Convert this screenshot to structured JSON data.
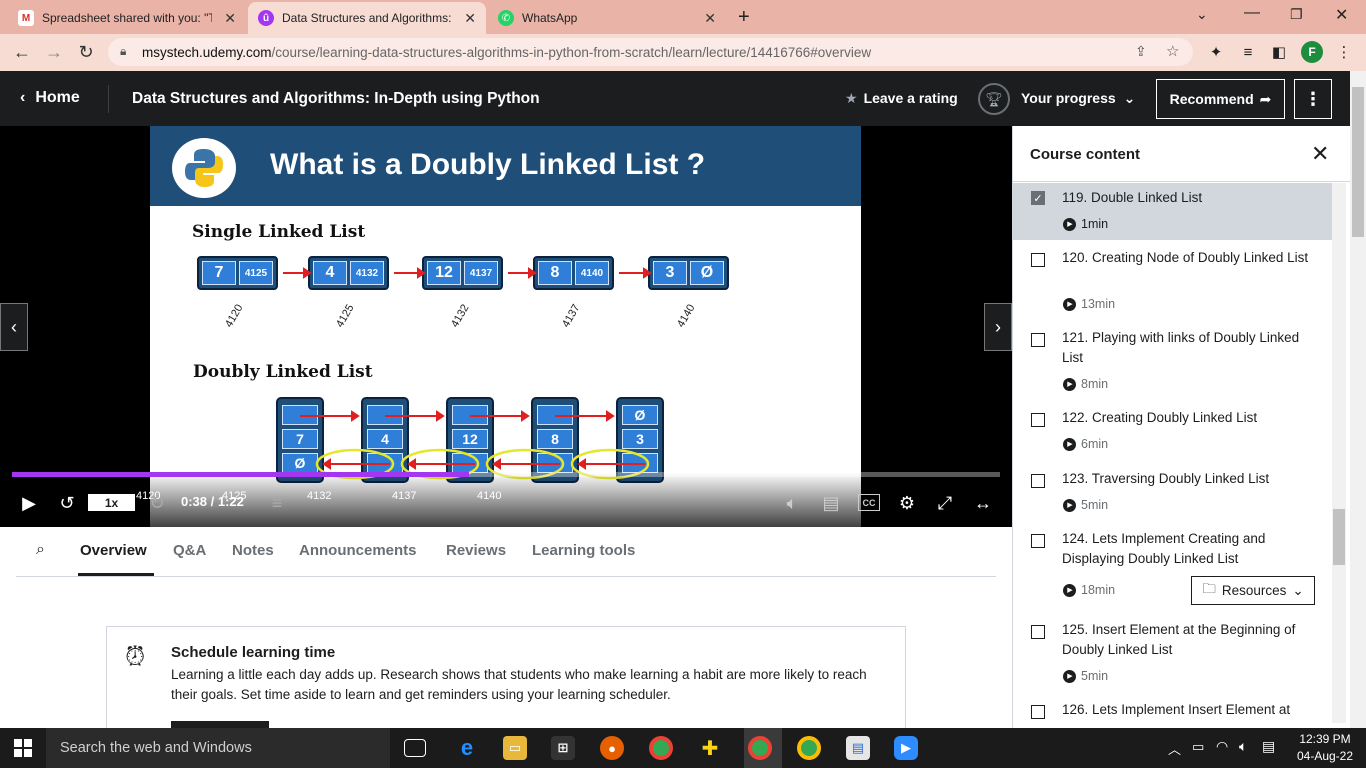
{
  "browser": {
    "tabs": [
      {
        "title": "Spreadsheet shared with you: \"Ti",
        "icon": "gmail-icon"
      },
      {
        "title": "Data Structures and Algorithms: I",
        "icon": "udemy-icon"
      },
      {
        "title": "WhatsApp",
        "icon": "whatsapp-icon"
      }
    ],
    "url_host": "msystech.udemy.com",
    "url_path": "/course/learning-data-structures-algorithms-in-python-from-scratch/learn/lecture/14416766#overview",
    "profile_initial": "F"
  },
  "header": {
    "home": "Home",
    "course_title": "Data Structures and Algorithms: In-Depth using Python",
    "rate": "Leave a rating",
    "progress": "Your progress",
    "recommend": "Recommend"
  },
  "slide": {
    "title": "What is a Doubly Linked List ?",
    "single_label": "Single Linked List",
    "doubly_label": "Doubly Linked List",
    "single_nodes": [
      {
        "value": "7",
        "next": "4125",
        "addr": "4120"
      },
      {
        "value": "4",
        "next": "4132",
        "addr": "4125"
      },
      {
        "value": "12",
        "next": "4137",
        "addr": "4132"
      },
      {
        "value": "8",
        "next": "4140",
        "addr": "4137"
      },
      {
        "value": "3",
        "next": "Ø",
        "addr": "4140"
      }
    ],
    "doubly_nodes": [
      {
        "value": "7",
        "prev": "Ø",
        "addr": "4120"
      },
      {
        "value": "4",
        "addr": "4125"
      },
      {
        "value": "12",
        "addr": "4132"
      },
      {
        "value": "8",
        "addr": "4137"
      },
      {
        "value": "3",
        "next": "Ø",
        "addr": "4140"
      }
    ]
  },
  "player": {
    "speed": "1x",
    "time": "0:38 / 1:22",
    "progress_fraction": 0.463
  },
  "course_tabs": [
    "Overview",
    "Q&A",
    "Notes",
    "Announcements",
    "Reviews",
    "Learning tools"
  ],
  "schedule": {
    "title": "Schedule learning time",
    "desc": "Learning a little each day adds up. Research shows that students who make learning a habit are more likely to reach their goals. Set time aside to learn and get reminders using your learning scheduler."
  },
  "sidebar": {
    "title": "Course content",
    "resources": "Resources",
    "lectures": [
      {
        "title": "119. Double Linked List",
        "duration": "1min",
        "done": true
      },
      {
        "title": "120. Creating Node of Doubly Linked List",
        "duration": "13min",
        "done": false
      },
      {
        "title": "121. Playing with links of Doubly Linked List",
        "duration": "8min",
        "done": false
      },
      {
        "title": "122. Creating Doubly Linked List",
        "duration": "6min",
        "done": false
      },
      {
        "title": "123. Traversing Doubly Linked List",
        "duration": "5min",
        "done": false
      },
      {
        "title": "124. Lets Implement Creating and Displaying Doubly Linked List",
        "duration": "18min",
        "done": false
      },
      {
        "title": "125. Insert Element at the Beginning of Doubly Linked List",
        "duration": "5min",
        "done": false
      },
      {
        "title": "126. Lets Implement Insert Element at",
        "duration": "",
        "done": false
      }
    ]
  },
  "taskbar": {
    "search": "Search the web and Windows",
    "time": "12:39 PM",
    "date": "04-Aug-22"
  },
  "colors": {
    "tabbar": "#e9b3a7",
    "udemy_dark": "#1c1d1f",
    "progress_purple": "#a435f0",
    "slide_blue": "#1f4e79"
  }
}
